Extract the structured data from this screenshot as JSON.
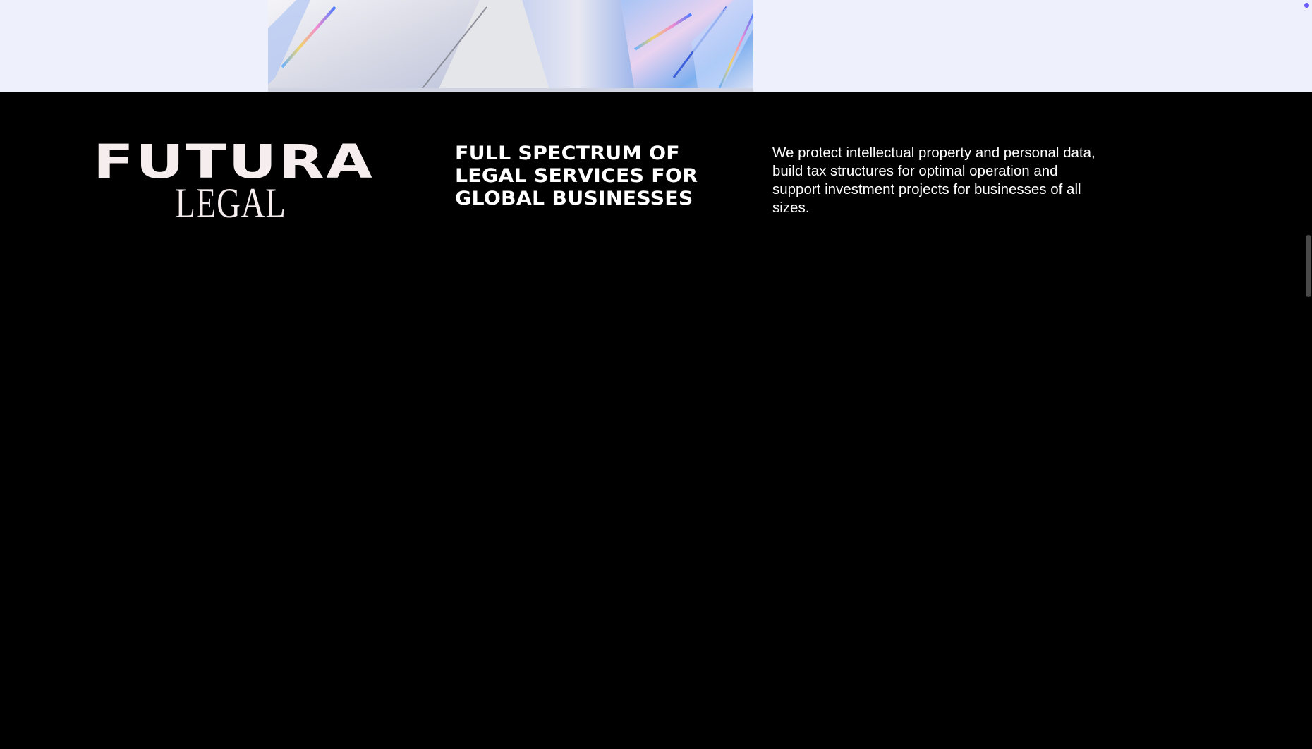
{
  "brand": {
    "name_top": "FUTURA",
    "name_bottom": "LEGAL"
  },
  "footer": {
    "tagline": "FULL SPECTRUM OF LEGAL SERVICES FOR GLOBAL BUSINESSES",
    "description": "We protect intellectual property and personal data, build tax structures for optimal operation and support investment projects for businesses of all sizes."
  },
  "colors": {
    "background": "#000000",
    "hero_background": "#eef1fb",
    "logo_text": "#f6eeee",
    "body_text": "#ffffff",
    "accent_dot": "#6a5cff"
  },
  "icons": {
    "hero_art": "crystal-image",
    "scroll_indicator": "scroll-dot-icon"
  }
}
